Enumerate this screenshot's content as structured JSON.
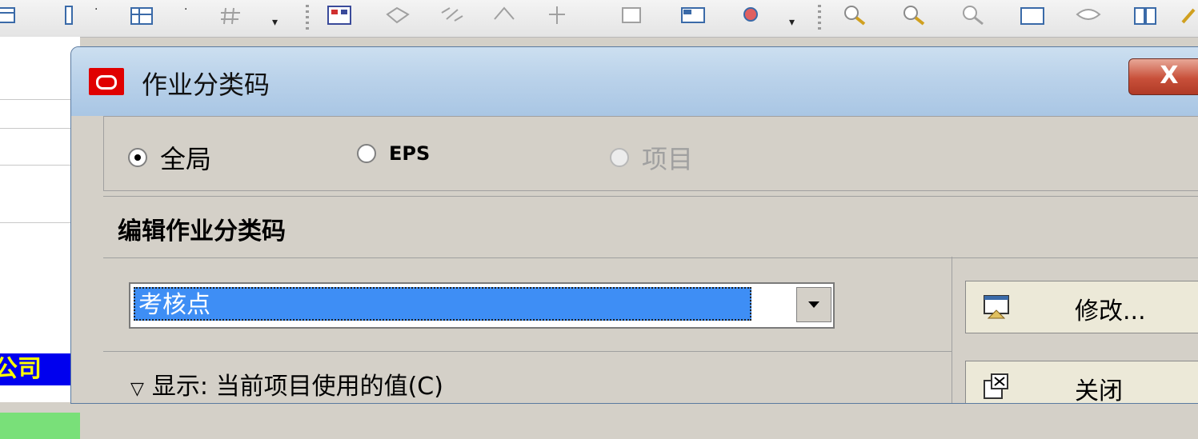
{
  "dialog": {
    "title": "作业分类码",
    "close_label": "X"
  },
  "scope": {
    "options": [
      {
        "label": "全局",
        "checked": true,
        "enabled": true
      },
      {
        "label": "EPS",
        "checked": false,
        "enabled": true
      },
      {
        "label": "项目",
        "checked": false,
        "enabled": false
      }
    ]
  },
  "edit": {
    "section_title": "编辑作业分类码",
    "selected_code": "考核点"
  },
  "buttons": {
    "modify_label": "修改...",
    "close_label": "关闭"
  },
  "list": {
    "header": "显示: 当前项目使用的值(C)"
  },
  "background": {
    "company_text": "公司"
  },
  "colors": {
    "title_icon": "#e00000",
    "selection": "#3e8ef5",
    "company_bg": "#0000ee",
    "company_text": "#ffff00"
  }
}
